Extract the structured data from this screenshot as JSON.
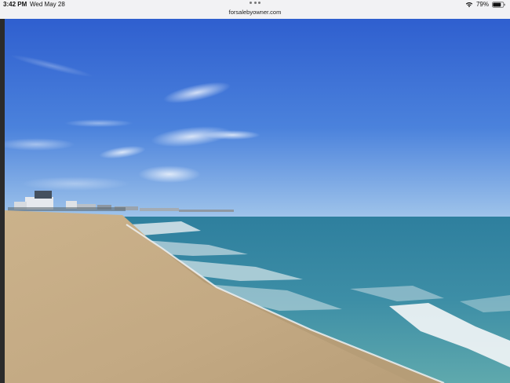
{
  "status_bar": {
    "time": "3:42 PM",
    "date": "Wed May 28",
    "battery_percent": "79%",
    "battery_level": 0.79,
    "wifi_icon": "wifi-icon",
    "battery_icon": "battery-icon"
  },
  "browser": {
    "url": "forsalebyowner.com",
    "tab_menu_icon": "more-dots-icon"
  },
  "photo": {
    "subject": "beach-photo",
    "colors": {
      "sky_top": "#2f5fcf",
      "sky_horizon": "#9ec3ea",
      "ocean_far": "#2e7f9e",
      "ocean_near": "#5fa9ad",
      "foam": "#f4f6f7",
      "sand_wet": "#b99f79",
      "sand_dry": "#cbb28b"
    }
  }
}
